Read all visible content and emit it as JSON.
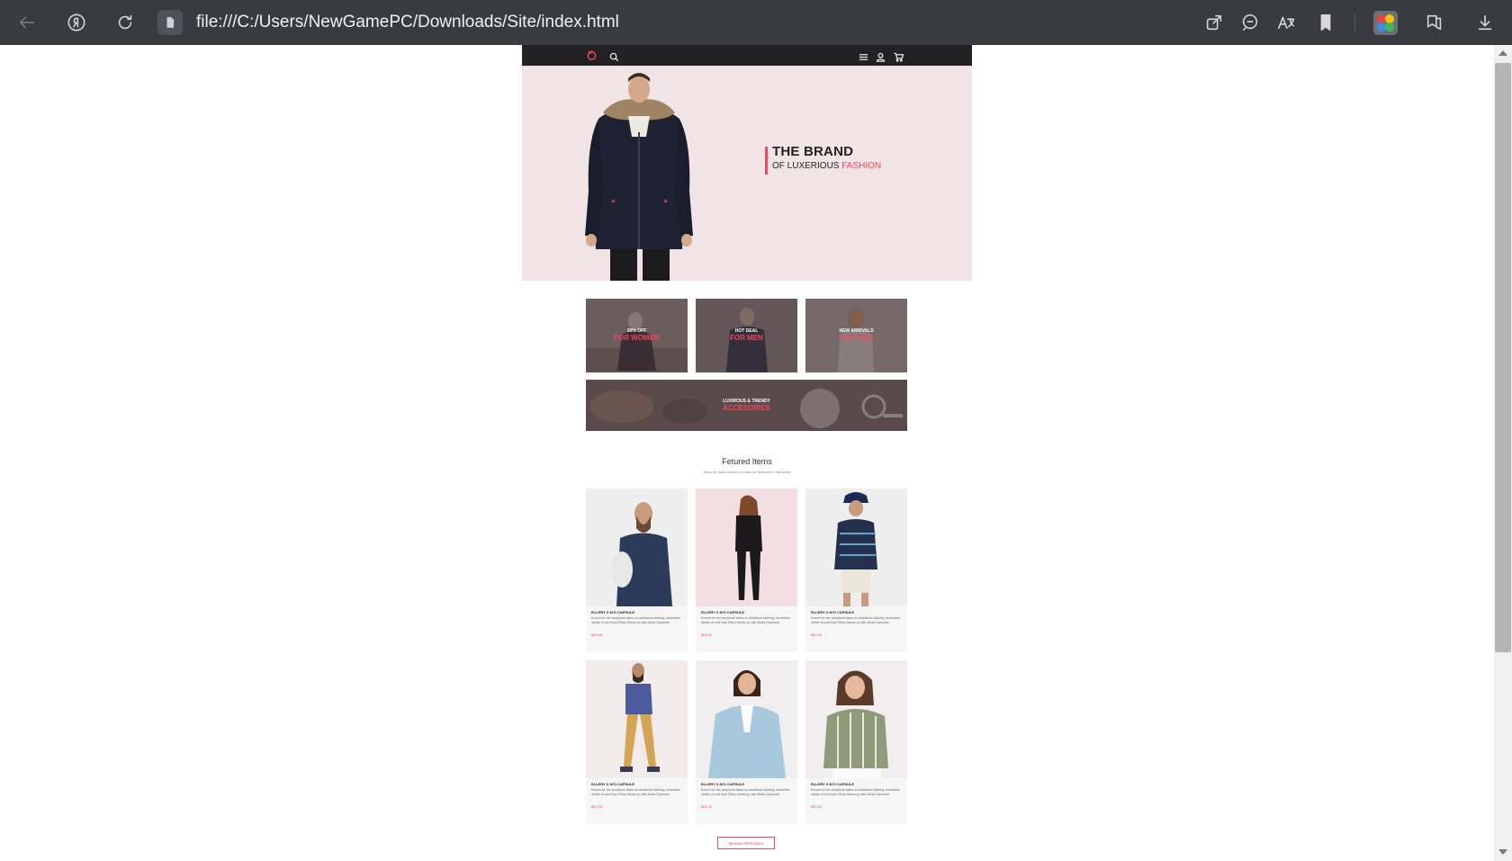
{
  "browser": {
    "url": "file:///C:/Users/NewGamePC/Downloads/Site/index.html"
  },
  "hero": {
    "title": "THE BRAND",
    "subtitle_prefix": "OF LUXERIOUS",
    "subtitle_accent": "FASHION"
  },
  "categories": [
    {
      "small": "30% OFF",
      "big": "FOR WOMEN"
    },
    {
      "small": "HOT DEAL",
      "big": "FOR MEN"
    },
    {
      "small": "NEW ARRIVALS",
      "big": "FOR KIDS"
    }
  ],
  "accessories": {
    "small": "LUXIROUS & TRENDY",
    "big": "ACCESORIES"
  },
  "featured": {
    "title": "Fetured Items",
    "subtitle": "Shop for items based on what we featured in this week"
  },
  "products": [
    {
      "name": "ELLERY X M'O CAPSULE",
      "desc": "Known for her sculptural takes on traditional tailoring, Australian arbiter of cool Kym Ellery teams up with Moda Operandi.",
      "price": "$52.00"
    },
    {
      "name": "ELLERY X M'O CAPSULE",
      "desc": "Known for her sculptural takes on traditional tailoring, Australian arbiter of cool Kym Ellery teams up with Moda Operandi.",
      "price": "$52.00"
    },
    {
      "name": "ELLERY X M'O CAPSULE",
      "desc": "Known for her sculptural takes on traditional tailoring, Australian arbiter of cool Kym Ellery teams up with Moda Operandi.",
      "price": "$52.00"
    },
    {
      "name": "ELLERY X M'O CAPSULE",
      "desc": "Known for her sculptural takes on traditional tailoring, Australian arbiter of cool Kym Ellery teams up with Moda Operandi.",
      "price": "$52.00"
    },
    {
      "name": "ELLERY X M'O CAPSULE",
      "desc": "Known for her sculptural takes on traditional tailoring, Australian arbiter of cool Kym Ellery teams up with Moda Operandi.",
      "price": "$52.00"
    },
    {
      "name": "ELLERY X M'O CAPSULE",
      "desc": "Known for her sculptural takes on traditional tailoring, Australian arbiter of cool Kym Ellery teams up with Moda Operandi.",
      "price": "$52.00"
    }
  ],
  "browse_button": "Browse All Product",
  "colors": {
    "accent": "#f0475b",
    "hero_bg": "#f1e4e6",
    "nav_bg": "#222224",
    "browser_bar": "#3a3b40"
  },
  "icons": {
    "browser": [
      "back-icon",
      "yandex-icon",
      "reload-icon",
      "file-icon",
      "share-icon",
      "chat-icon",
      "translate-icon",
      "bookmark-icon",
      "extension-icon",
      "collections-icon",
      "download-icon"
    ],
    "site_nav": [
      "logo-icon",
      "search-icon",
      "menu-icon",
      "user-icon",
      "cart-icon"
    ]
  }
}
